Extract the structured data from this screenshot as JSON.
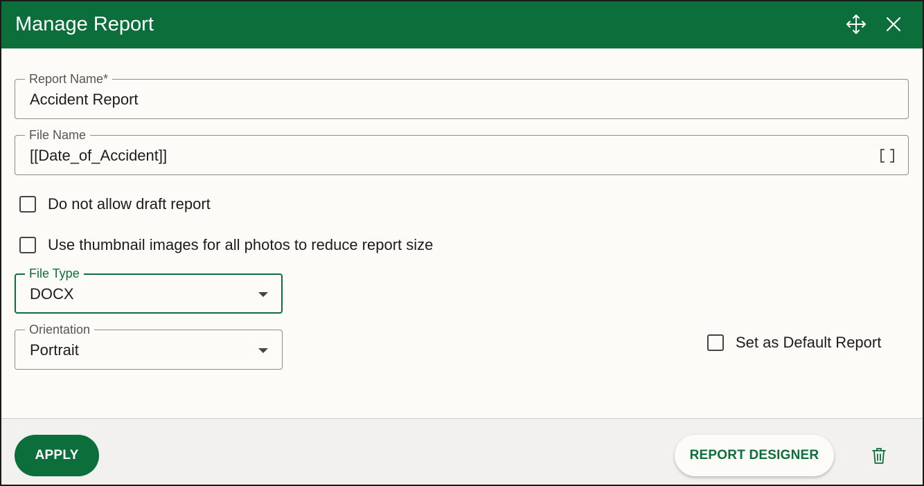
{
  "dialog": {
    "title": "Manage Report",
    "icons": {
      "move": "move-arrows-icon",
      "close": "close-icon"
    }
  },
  "fields": {
    "report_name": {
      "label": "Report Name*",
      "value": "Accident Report"
    },
    "file_name": {
      "label": "File Name",
      "value": "[[Date_of_Accident]]",
      "icon": "bracket-icon"
    },
    "file_type": {
      "label": "File Type",
      "value": "DOCX"
    },
    "orientation": {
      "label": "Orientation",
      "value": "Portrait"
    }
  },
  "checkboxes": {
    "no_draft": {
      "label": "Do not allow draft report",
      "checked": false
    },
    "thumbnails": {
      "label": "Use thumbnail images for all photos to reduce report size",
      "checked": false
    },
    "default_report": {
      "label": "Set as Default Report",
      "checked": false
    }
  },
  "footer": {
    "apply_label": "APPLY",
    "designer_label": "REPORT DESIGNER",
    "delete_icon": "trash-icon"
  },
  "colors": {
    "accent": "#0c6e3b",
    "background": "#fcfbf8",
    "footer_bg": "#f2f1ef"
  }
}
